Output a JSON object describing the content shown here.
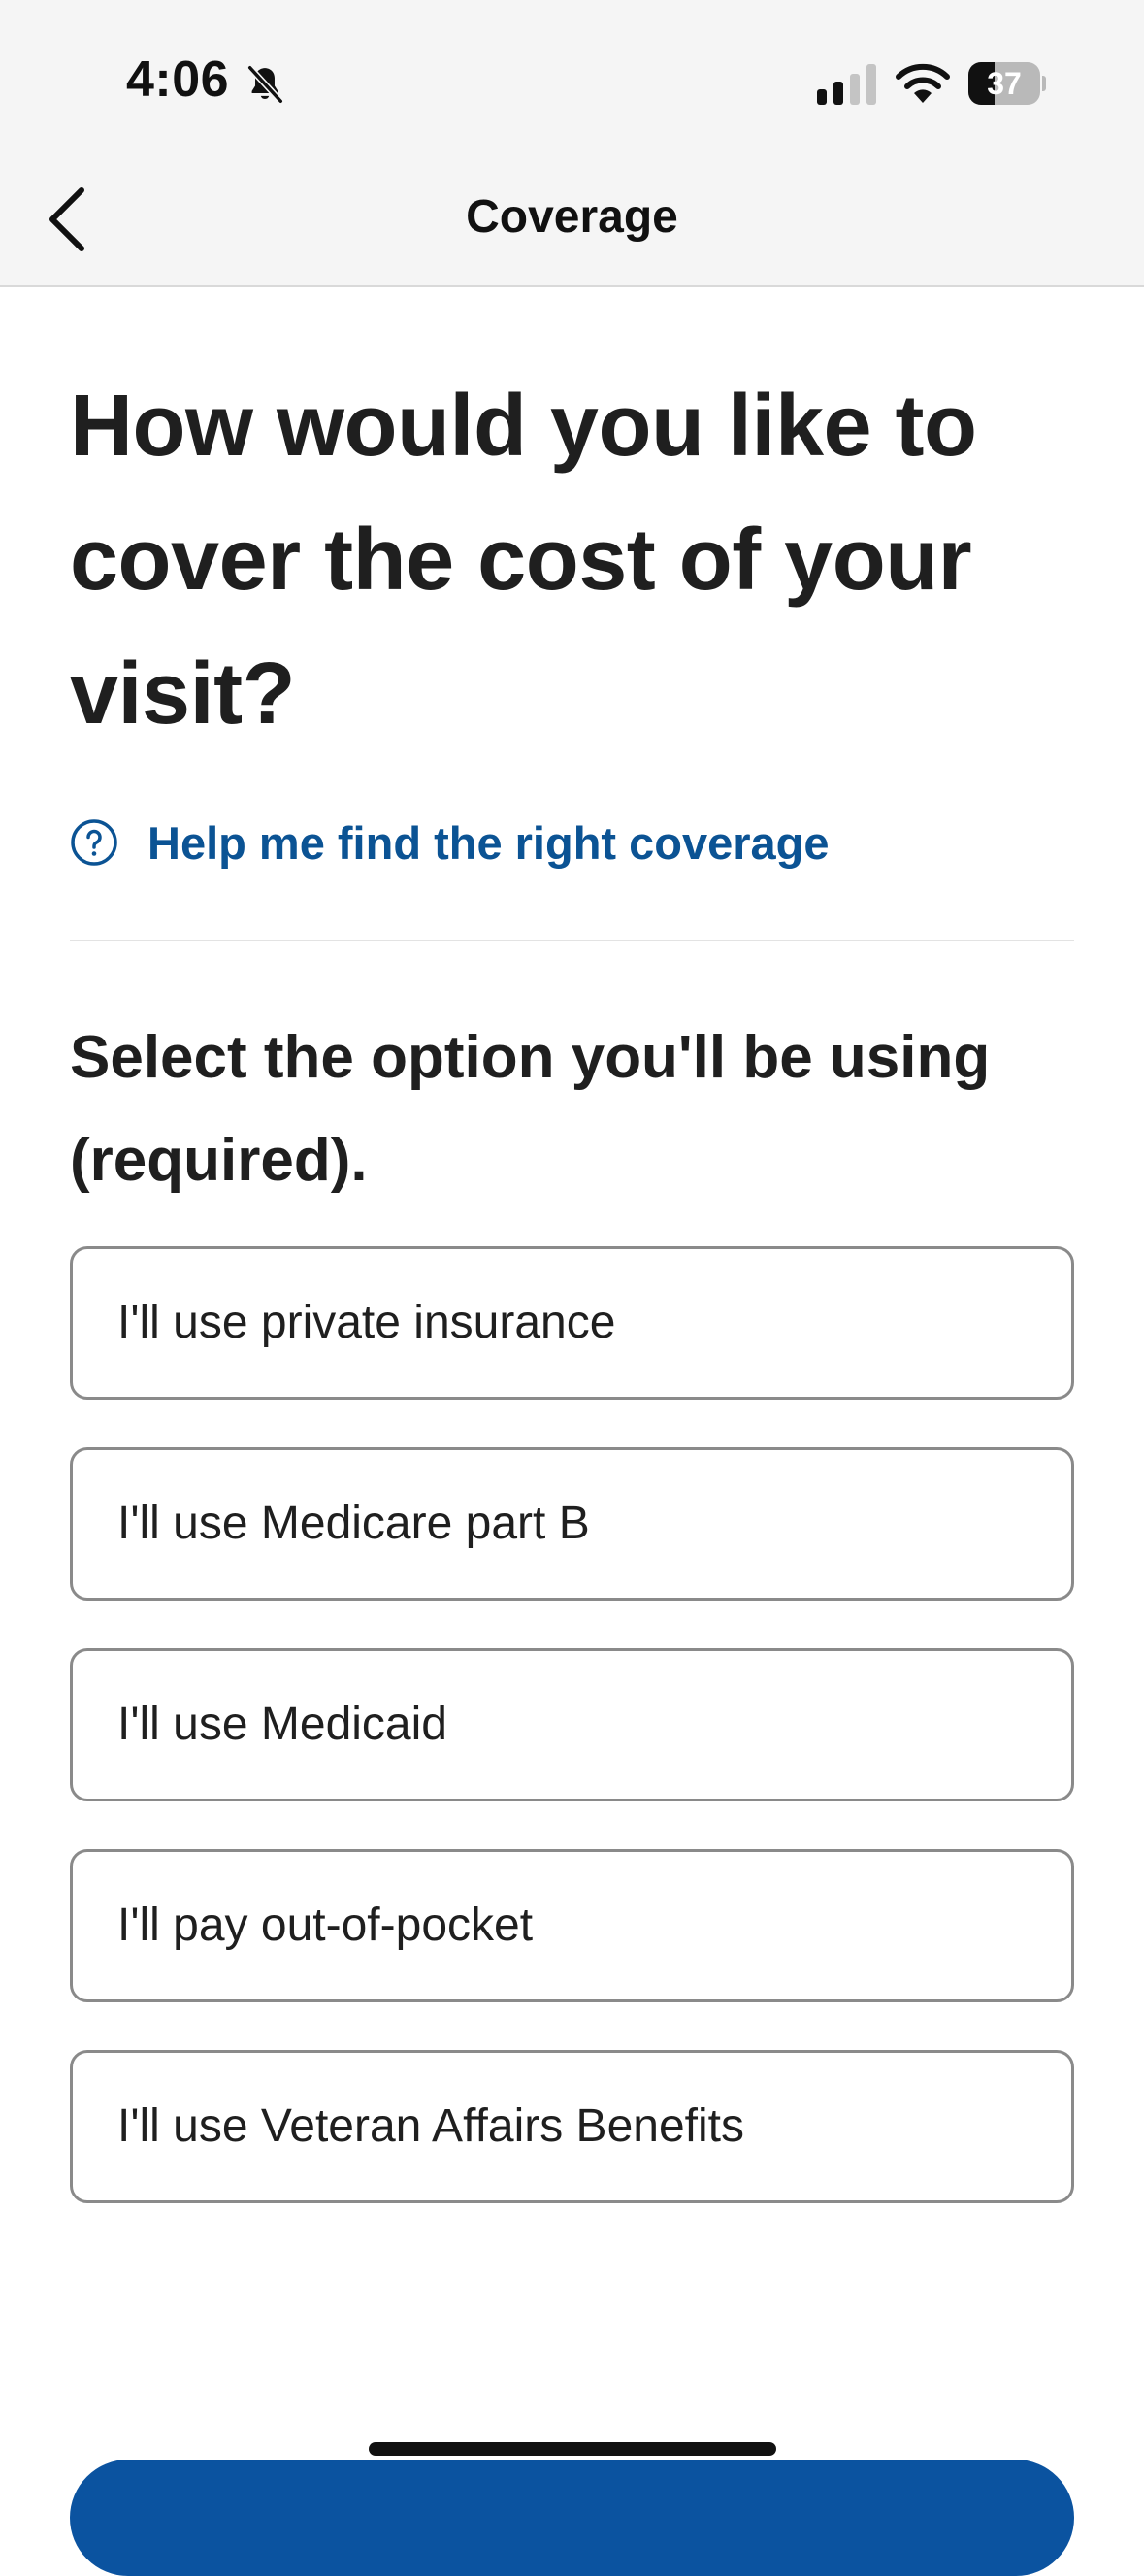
{
  "status_bar": {
    "time": "4:06",
    "battery_level": "37",
    "battery_fraction": 0.37
  },
  "nav": {
    "title": "Coverage",
    "back_icon": "chevron-left-icon"
  },
  "main": {
    "heading": "How would you like to cover the cost of your visit?",
    "help_link": {
      "icon": "question-circle-icon",
      "label": "Help me find the right coverage"
    },
    "select_label": "Select the option you'll be using (required).",
    "options": [
      {
        "label": "I'll use private insurance"
      },
      {
        "label": "I'll use Medicare part B"
      },
      {
        "label": "I'll use Medicaid"
      },
      {
        "label": "I'll pay out-of-pocket"
      },
      {
        "label": "I'll use Veteran Affairs Benefits"
      }
    ]
  },
  "colors": {
    "accent": "#0b5394",
    "button": "#0b53a0",
    "text": "#1f1f1f",
    "option_border": "#8a8a8a",
    "header_bg": "#f5f5f5"
  }
}
